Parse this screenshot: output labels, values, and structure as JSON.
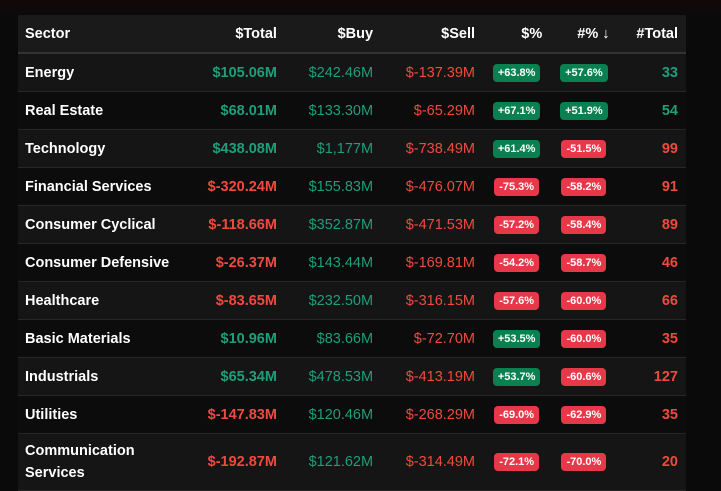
{
  "headers": {
    "sector": "Sector",
    "total": "$Total",
    "buy": "$Buy",
    "sell": "$Sell",
    "pct": "$%",
    "cnt_pct": "#% ↓",
    "cnt_total": "#Total"
  },
  "colors": {
    "positive": "#1f9e7a",
    "negative": "#f04a3f",
    "badge_positive": "#08804f",
    "badge_negative": "#e63848"
  },
  "rows": [
    {
      "sector": "Energy",
      "total": "$105.06M",
      "buy": "$242.46M",
      "sell": "$-137.39M",
      "pct": "+63.8%",
      "cnt_pct": "+57.6%",
      "cnt_total": "33"
    },
    {
      "sector": "Real Estate",
      "total": "$68.01M",
      "buy": "$133.30M",
      "sell": "$-65.29M",
      "pct": "+67.1%",
      "cnt_pct": "+51.9%",
      "cnt_total": "54"
    },
    {
      "sector": "Technology",
      "total": "$438.08M",
      "buy": "$1,177M",
      "sell": "$-738.49M",
      "pct": "+61.4%",
      "cnt_pct": "-51.5%",
      "cnt_total": "99"
    },
    {
      "sector": "Financial Services",
      "total": "$-320.24M",
      "buy": "$155.83M",
      "sell": "$-476.07M",
      "pct": "-75.3%",
      "cnt_pct": "-58.2%",
      "cnt_total": "91"
    },
    {
      "sector": "Consumer Cyclical",
      "total": "$-118.66M",
      "buy": "$352.87M",
      "sell": "$-471.53M",
      "pct": "-57.2%",
      "cnt_pct": "-58.4%",
      "cnt_total": "89"
    },
    {
      "sector": "Consumer Defensive",
      "total": "$-26.37M",
      "buy": "$143.44M",
      "sell": "$-169.81M",
      "pct": "-54.2%",
      "cnt_pct": "-58.7%",
      "cnt_total": "46"
    },
    {
      "sector": "Healthcare",
      "total": "$-83.65M",
      "buy": "$232.50M",
      "sell": "$-316.15M",
      "pct": "-57.6%",
      "cnt_pct": "-60.0%",
      "cnt_total": "66"
    },
    {
      "sector": "Basic Materials",
      "total": "$10.96M",
      "buy": "$83.66M",
      "sell": "$-72.70M",
      "pct": "+53.5%",
      "cnt_pct": "-60.0%",
      "cnt_total": "35"
    },
    {
      "sector": "Industrials",
      "total": "$65.34M",
      "buy": "$478.53M",
      "sell": "$-413.19M",
      "pct": "+53.7%",
      "cnt_pct": "-60.6%",
      "cnt_total": "127"
    },
    {
      "sector": "Utilities",
      "total": "$-147.83M",
      "buy": "$120.46M",
      "sell": "$-268.29M",
      "pct": "-69.0%",
      "cnt_pct": "-62.9%",
      "cnt_total": "35"
    },
    {
      "sector": "Communication Services",
      "total": "$-192.87M",
      "buy": "$121.62M",
      "sell": "$-314.49M",
      "pct": "-72.1%",
      "cnt_pct": "-70.0%",
      "cnt_total": "20"
    }
  ]
}
